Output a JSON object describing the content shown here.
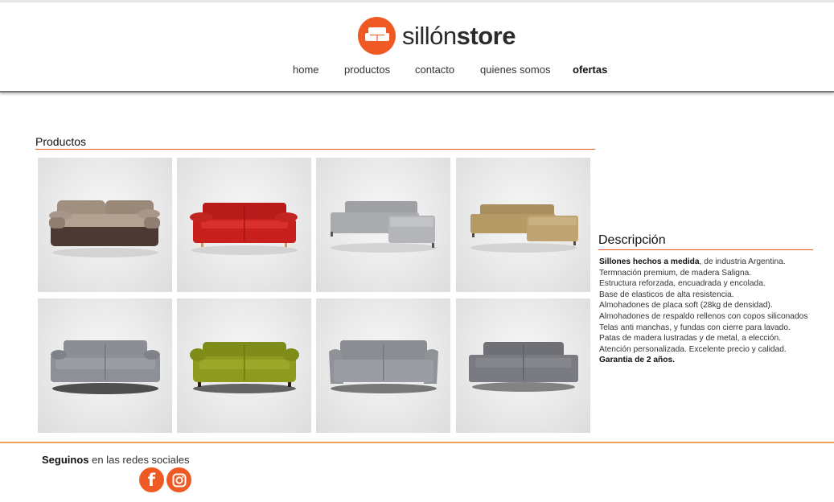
{
  "brand": {
    "name_light": "sillón",
    "name_bold": "store",
    "accent_color": "#ef5a24"
  },
  "nav": {
    "items": [
      {
        "label": "home",
        "bold": false
      },
      {
        "label": "productos",
        "bold": false
      },
      {
        "label": "contacto",
        "bold": false
      },
      {
        "label": "quienes somos",
        "bold": false
      },
      {
        "label": "ofertas",
        "bold": true
      }
    ]
  },
  "products": {
    "title": "Productos",
    "items": [
      {
        "icon": "sofa-brown-beige-image",
        "color": "#8b7a6b"
      },
      {
        "icon": "sofa-red-image",
        "color": "#c8201c"
      },
      {
        "icon": "sectional-grey-image",
        "color": "#a9a9ad"
      },
      {
        "icon": "sectional-tan-image",
        "color": "#b59a66"
      },
      {
        "icon": "sofa-grey-dark-image",
        "color": "#8d9096"
      },
      {
        "icon": "sofa-olive-image",
        "color": "#8d9a1e"
      },
      {
        "icon": "sofa-grey-armrest-image",
        "color": "#8f9296"
      },
      {
        "icon": "sofa-grey-compact-image",
        "color": "#7a7b80"
      }
    ]
  },
  "description": {
    "title": "Descripción",
    "lines": [
      {
        "bold": "Sillones hechos a medida",
        "text": ", de industria Argentina."
      },
      {
        "bold": "",
        "text": "Termnación premium, de madera Saligna."
      },
      {
        "bold": "",
        "text": "Estructura reforzada, encuadrada y encolada."
      },
      {
        "bold": "",
        "text": "Base de elasticos de alta resistencia."
      },
      {
        "bold": "",
        "text": "Almohadones de placa soft (28kg de densidad)."
      },
      {
        "bold": "",
        "text": "Almohadones de respaldo rellenos con copos siliconados"
      },
      {
        "bold": "",
        "text": "Telas anti manchas, y fundas con cierre para lavado."
      },
      {
        "bold": "",
        "text": "Patas de madera lustradas y de metal, a elección."
      },
      {
        "bold": "",
        "text": "Atención personalizada. Excelente precio y calidad."
      },
      {
        "bold": "Garantia de 2 años.",
        "text": ""
      }
    ]
  },
  "footer": {
    "lead_bold": "Seguinos",
    "lead_text": " en las redes sociales",
    "social": [
      {
        "icon": "facebook-icon",
        "glyph": "f"
      },
      {
        "icon": "instagram-icon",
        "glyph": ""
      }
    ]
  }
}
